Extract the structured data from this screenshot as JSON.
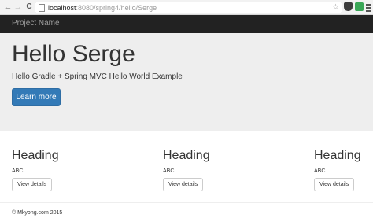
{
  "browser": {
    "url_host": "localhost",
    "url_path": ":8080/spring4/hello/Serge",
    "back_glyph": "←",
    "forward_glyph": "→",
    "reload_glyph": "C",
    "star_glyph": "☆"
  },
  "navbar": {
    "brand": "Project Name"
  },
  "jumbotron": {
    "title": "Hello Serge",
    "subtitle": "Hello Gradle + Spring MVC Hello World Example",
    "button_label": "Learn more"
  },
  "columns": [
    {
      "heading": "Heading",
      "text": "ABC",
      "button_label": "View details"
    },
    {
      "heading": "Heading",
      "text": "ABC",
      "button_label": "View details"
    },
    {
      "heading": "Heading",
      "text": "ABC",
      "button_label": "View details"
    }
  ],
  "footer": {
    "text": "© Mkyong.com 2015"
  },
  "colors": {
    "navbar_bg": "#222222",
    "jumbotron_bg": "#eeeeee",
    "primary_button": "#337ab7"
  }
}
